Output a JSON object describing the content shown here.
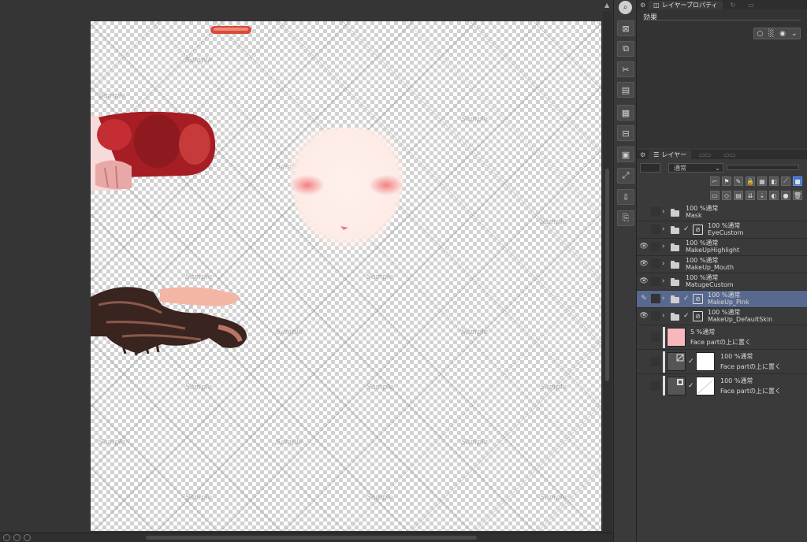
{
  "canvas": {
    "watermark_text": "Sample"
  },
  "panel": {
    "properties_tab": "レイヤープロパティ",
    "effect_label": "効果",
    "layers_tab": "レイヤー",
    "blend_mode": "通常",
    "layers": [
      {
        "opacity": "100 %通常",
        "name": "Mask",
        "type": "folder",
        "visible": false,
        "selected": false
      },
      {
        "opacity": "100 %通常",
        "name": "EyeCustom",
        "type": "folder-masked",
        "visible": false,
        "selected": false
      },
      {
        "opacity": "100 %通常",
        "name": "MakeUpHighlight",
        "type": "folder",
        "visible": true,
        "selected": false
      },
      {
        "opacity": "100 %通常",
        "name": "MakeUp_Mouth",
        "type": "folder",
        "visible": true,
        "selected": false
      },
      {
        "opacity": "100 %通常",
        "name": "MatugeCustom",
        "type": "folder",
        "visible": true,
        "selected": false
      },
      {
        "opacity": "100 %通常",
        "name": "MakeUp_Pink",
        "type": "folder-masked",
        "visible": true,
        "selected": true
      },
      {
        "opacity": "100 %通常",
        "name": "MakeUp_DefaultSkin",
        "type": "folder-masked",
        "visible": true,
        "selected": false
      },
      {
        "opacity": "5 %通常",
        "name": "Face partの上に置く",
        "type": "fill",
        "fill_color": "#f7b7bd",
        "visible": false,
        "selected": false
      },
      {
        "opacity": "100 %通常",
        "name": "Face partの上に置く",
        "type": "gradient",
        "visible": false,
        "selected": false
      },
      {
        "opacity": "100 %通常",
        "name": "Face partの上に置く",
        "type": "gradient",
        "visible": false,
        "selected": false
      }
    ]
  }
}
